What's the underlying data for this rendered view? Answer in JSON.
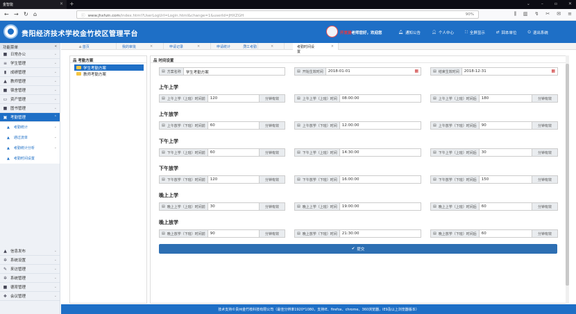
{
  "browser": {
    "tab_title": "金智能",
    "url_prefix": "www.jhxhzn.com",
    "url_path": "/index.html?UserLogUrl=Login.html&change=1&userId=JHXZGH",
    "zoom": "90%"
  },
  "header": {
    "site_title": "贵阳经济技术学校金竹校区管理平台",
    "user_name": "开发测",
    "greeting": "老师您好，欢迎您",
    "menu": [
      "通知公告",
      "个人中心",
      "全屏显示",
      "回本单位",
      "退出系统"
    ]
  },
  "sidebar": {
    "title": "功能菜单",
    "items_top": [
      {
        "label": "日常办公",
        "icon": "briefcase-icon"
      },
      {
        "label": "学生管理",
        "icon": "id-card-icon"
      },
      {
        "label": "成绩管理",
        "icon": "bar-chart-icon"
      },
      {
        "label": "教师管理",
        "icon": "user-icon"
      },
      {
        "label": "宿舍管理",
        "icon": "building-icon"
      },
      {
        "label": "资产管理",
        "icon": "cash-icon"
      },
      {
        "label": "图书管理",
        "icon": "book-icon"
      },
      {
        "label": "考勤管理",
        "icon": "calendar-icon"
      }
    ],
    "sub_items": [
      "考勤统计",
      "通过流单",
      "考勤统计分析",
      "考勤时间设置"
    ],
    "items_bottom": [
      {
        "label": "信息发布",
        "icon": "bell-icon"
      },
      {
        "label": "系统设置",
        "icon": "gear-icon"
      },
      {
        "label": "来访管理",
        "icon": "edit-icon"
      },
      {
        "label": "系统管理",
        "icon": "gear-icon"
      },
      {
        "label": "德育管理",
        "icon": "flag-icon"
      },
      {
        "label": "会议管理",
        "icon": "users-icon"
      }
    ]
  },
  "tabs": [
    "首页",
    "我的审批",
    "申请记录",
    "申请统计",
    "员工考勤",
    "考勤时间设置"
  ],
  "tree": {
    "title": "考勤方案",
    "nodes": [
      "学生考勤方案",
      "教师考勤方案"
    ]
  },
  "form": {
    "title": "时间设置",
    "top_fields": [
      {
        "label": "方案名称",
        "value": "学生考勤方案"
      },
      {
        "label": "开始生效时间",
        "value": "2018-01-01"
      },
      {
        "label": "结束生效时间",
        "value": "2018-12-31"
      }
    ],
    "suffix": "分钟有效",
    "sections": [
      {
        "title": "上午上学",
        "before_label": "上午上学（上班）时间前",
        "before_value": "120",
        "time_label": "上午上学（上班）时间",
        "time_value": "08:00:00",
        "after_label": "上午上学（上班）时间后",
        "after_value": "180"
      },
      {
        "title": "上午放学",
        "before_label": "上午放学（下班）时间前",
        "before_value": "60",
        "time_label": "上午放学（下班）时间",
        "time_value": "12:00:00",
        "after_label": "上午放学（下班）时间后",
        "after_value": "90"
      },
      {
        "title": "下午上学",
        "before_label": "下午上学（上班）时间前",
        "before_value": "60",
        "time_label": "下午上学（上班）时间",
        "time_value": "14:30:00",
        "after_label": "下午上学（上班）时间后",
        "after_value": "30"
      },
      {
        "title": "下午放学",
        "before_label": "下午放学（下班）时间前",
        "before_value": "120",
        "time_label": "下午放学（下班）时间",
        "time_value": "16:00:00",
        "after_label": "下午放学（下班）时间后",
        "after_value": "150"
      },
      {
        "title": "晚上上学",
        "before_label": "晚上上学（上班）时间前",
        "before_value": "30",
        "time_label": "晚上上学（上班）时间",
        "time_value": "19:00:00",
        "after_label": "晚上上学（上班）时间后",
        "after_value": "60"
      },
      {
        "title": "晚上放学",
        "before_label": "晚上放学（下班）时间前",
        "before_value": "90",
        "time_label": "晚上放学（下班）时间",
        "time_value": "21:30:00",
        "after_label": "晚上放学（下班）时间后",
        "after_value": "60"
      }
    ],
    "submit_label": "提交"
  },
  "footer": "技术支持©贵州金竹枝科技有限公司（最佳分辨率1920*1080，支持IE、firefox、chrome、360浏览器，IE9及以上浏览器版本）",
  "colors": {
    "primary": "#1e6fc6",
    "submit": "#2d6fb3"
  }
}
